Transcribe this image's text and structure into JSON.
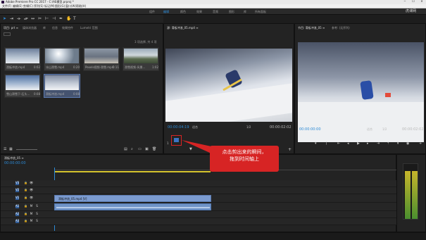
{
  "titlebar": {
    "title": "Adobe Premiere Pro CC 2017 - C:\\AE模型.prproj *",
    "minimize": "─",
    "maximize": "☐",
    "close": "✕"
  },
  "menu": [
    "文件(F)",
    "编辑(E)",
    "剪辑(C)",
    "序列(S)",
    "标记(M)",
    "图形(G)",
    "窗口(W)",
    "帮助(H)"
  ],
  "workspaces": [
    "组件",
    "编辑",
    "颜色",
    "效果",
    "音频",
    "图形",
    "库",
    "所有面板"
  ],
  "active_workspace": "编辑",
  "watermark": "虎课网",
  "project": {
    "tabs": [
      "项目: prt ≡",
      "媒体浏览器",
      "库",
      "信息",
      "效果控件",
      "Lumetri 范围"
    ],
    "item_count": "3 项选择, 共 4 项",
    "clips": [
      {
        "name": "滑板冲浪.mp4",
        "dur": "0:02"
      },
      {
        "name": "冰山滑雪.mp4",
        "dur": "0:20"
      },
      {
        "name": "Pexels视频-滑雪.mp4",
        "dur": "0:11"
      },
      {
        "name": "滑雪视频-风景...",
        "dur": "1:02"
      },
      {
        "name": "雪山滑雪下-石头...",
        "dur": "0:08"
      },
      {
        "name": "滑板冲浪.mp4",
        "dur": "0:08"
      }
    ]
  },
  "source": {
    "tab": "源: 滑板冲浪_05.mp4 ≡",
    "timecode": "00:00:04:19",
    "fit": "适合",
    "quality": "1/2",
    "duration": "00:00:02:02",
    "marker": "1"
  },
  "program": {
    "tab": "节目: 滑板冲浪_05 ≡",
    "subtab": "参考: (无序列)",
    "timecode": "00:00:00:00",
    "fit": "适合",
    "quality": "1/2",
    "duration": "00:00:02:02"
  },
  "timeline": {
    "tab": "滑板冲浪_05 ≡",
    "timecode": "00:00:00:00",
    "clip_label": "滑板冲浪_05.mp4 [V]",
    "tracks": [
      "V3",
      "V2",
      "V1",
      "A1",
      "A2",
      "A3"
    ]
  },
  "callout": {
    "line1": "点击剪出来的瞬间，",
    "line2": "拖到时间轴上"
  }
}
